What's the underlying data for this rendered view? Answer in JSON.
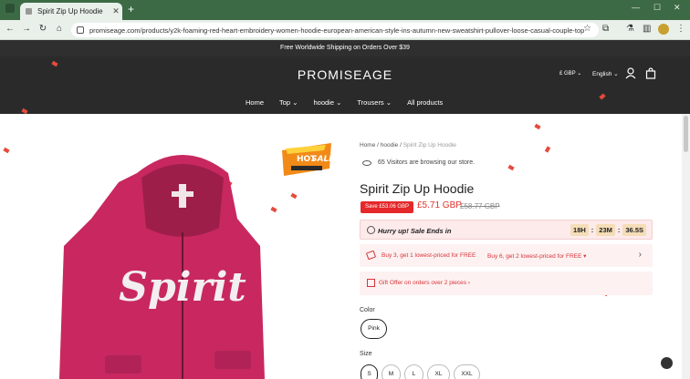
{
  "browser": {
    "tab_title": "Spirit Zip Up Hoodie",
    "url": "promiseage.com/products/y2k-foaming-red-heart-embroidery-women-hoodie-european-american-style-ins-autumn-new-sweatshirt-pullover-loose-casual-couple-top",
    "tab_close": "✕",
    "new_tab": "+"
  },
  "site": {
    "announcement": "Free Worldwide Shipping on Orders Over $39",
    "logo": "PROMISEAGE",
    "currency": "£ GBP",
    "language": "English",
    "nav": [
      {
        "label": "Home"
      },
      {
        "label": "Top ⌄"
      },
      {
        "label": "hoodie ⌄"
      },
      {
        "label": "Trousers ⌄"
      },
      {
        "label": "All products"
      }
    ]
  },
  "product": {
    "breadcrumb": {
      "home": "Home",
      "sep": " / ",
      "category": "hoodie",
      "current": "Spirit Zip Up Hoodie"
    },
    "visitors": "65 Visitors are browsing our store.",
    "title": "Spirit Zip Up Hoodie",
    "save_badge": "Save £53.06 GBP",
    "price": "£5.71 GBP",
    "compare_price": "£58.77 GBP",
    "hurry_text": "Hurry up! Sale Ends in",
    "timer": {
      "hours": "18H",
      "minutes": "23M",
      "seconds": "36.5S"
    },
    "offers": {
      "offer1": "Buy 3, get 1 lowest-priced for FREE",
      "offer2": "Buy 6, get 2 lowest-priced for FREE",
      "arrow": "›"
    },
    "gift": "Gift Offer on orders over 2 pieces  ›",
    "color_label": "Color",
    "color_selected": "Pink",
    "size_label": "Size",
    "sizes": [
      "S",
      "M",
      "L",
      "XL",
      "XXL"
    ],
    "hoodie_print": "Spirit",
    "hot_sale": {
      "line1": "HOT",
      "line2": "SALE"
    }
  },
  "colors": {
    "accent_red": "#e5282a",
    "header_bg": "#2a2a2a",
    "hoodie_pink": "#c8285f",
    "browser_green": "#3c6a45"
  }
}
